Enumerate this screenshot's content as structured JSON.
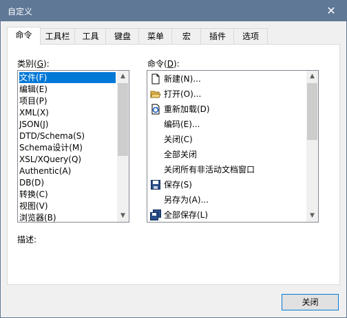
{
  "window": {
    "title": "自定义"
  },
  "tabs": [
    {
      "label": "命令"
    },
    {
      "label": "工具栏"
    },
    {
      "label": "工具"
    },
    {
      "label": "键盘"
    },
    {
      "label": "菜单"
    },
    {
      "label": "宏"
    },
    {
      "label": "插件"
    },
    {
      "label": "选项"
    }
  ],
  "categories": {
    "label_prefix": "类别(",
    "label_key": "G",
    "label_suffix": "):",
    "items": [
      "文件(F)",
      "编辑(E)",
      "项目(P)",
      "XML(X)",
      "JSON(J)",
      "DTD/Schema(S)",
      "Schema设计(M)",
      "XSL/XQuery(Q)",
      "Authentic(A)",
      "DB(D)",
      "转换(C)",
      "视图(V)",
      "浏览器(B)"
    ],
    "selected_index": 0
  },
  "commands": {
    "label_prefix": "命令(",
    "label_key": "D",
    "label_suffix": "):",
    "items": [
      {
        "label": "新建(N)...",
        "icon": "new-file-icon"
      },
      {
        "label": "打开(O)...",
        "icon": "open-folder-icon"
      },
      {
        "label": "重新加载(D)",
        "icon": "reload-icon"
      },
      {
        "label": "编码(E)...",
        "icon": ""
      },
      {
        "label": "关闭(C)",
        "icon": ""
      },
      {
        "label": "全部关闭",
        "icon": ""
      },
      {
        "label": "关闭所有非活动文档窗口",
        "icon": ""
      },
      {
        "label": "保存(S)",
        "icon": "save-icon"
      },
      {
        "label": "另存为(A)...",
        "icon": ""
      },
      {
        "label": "全部保存(L)",
        "icon": "save-all-icon"
      }
    ]
  },
  "description": {
    "label": "描述:"
  },
  "close_button": {
    "label": "关闭"
  },
  "colors": {
    "titlebar": "#5f7896",
    "selection": "#0078d7"
  }
}
